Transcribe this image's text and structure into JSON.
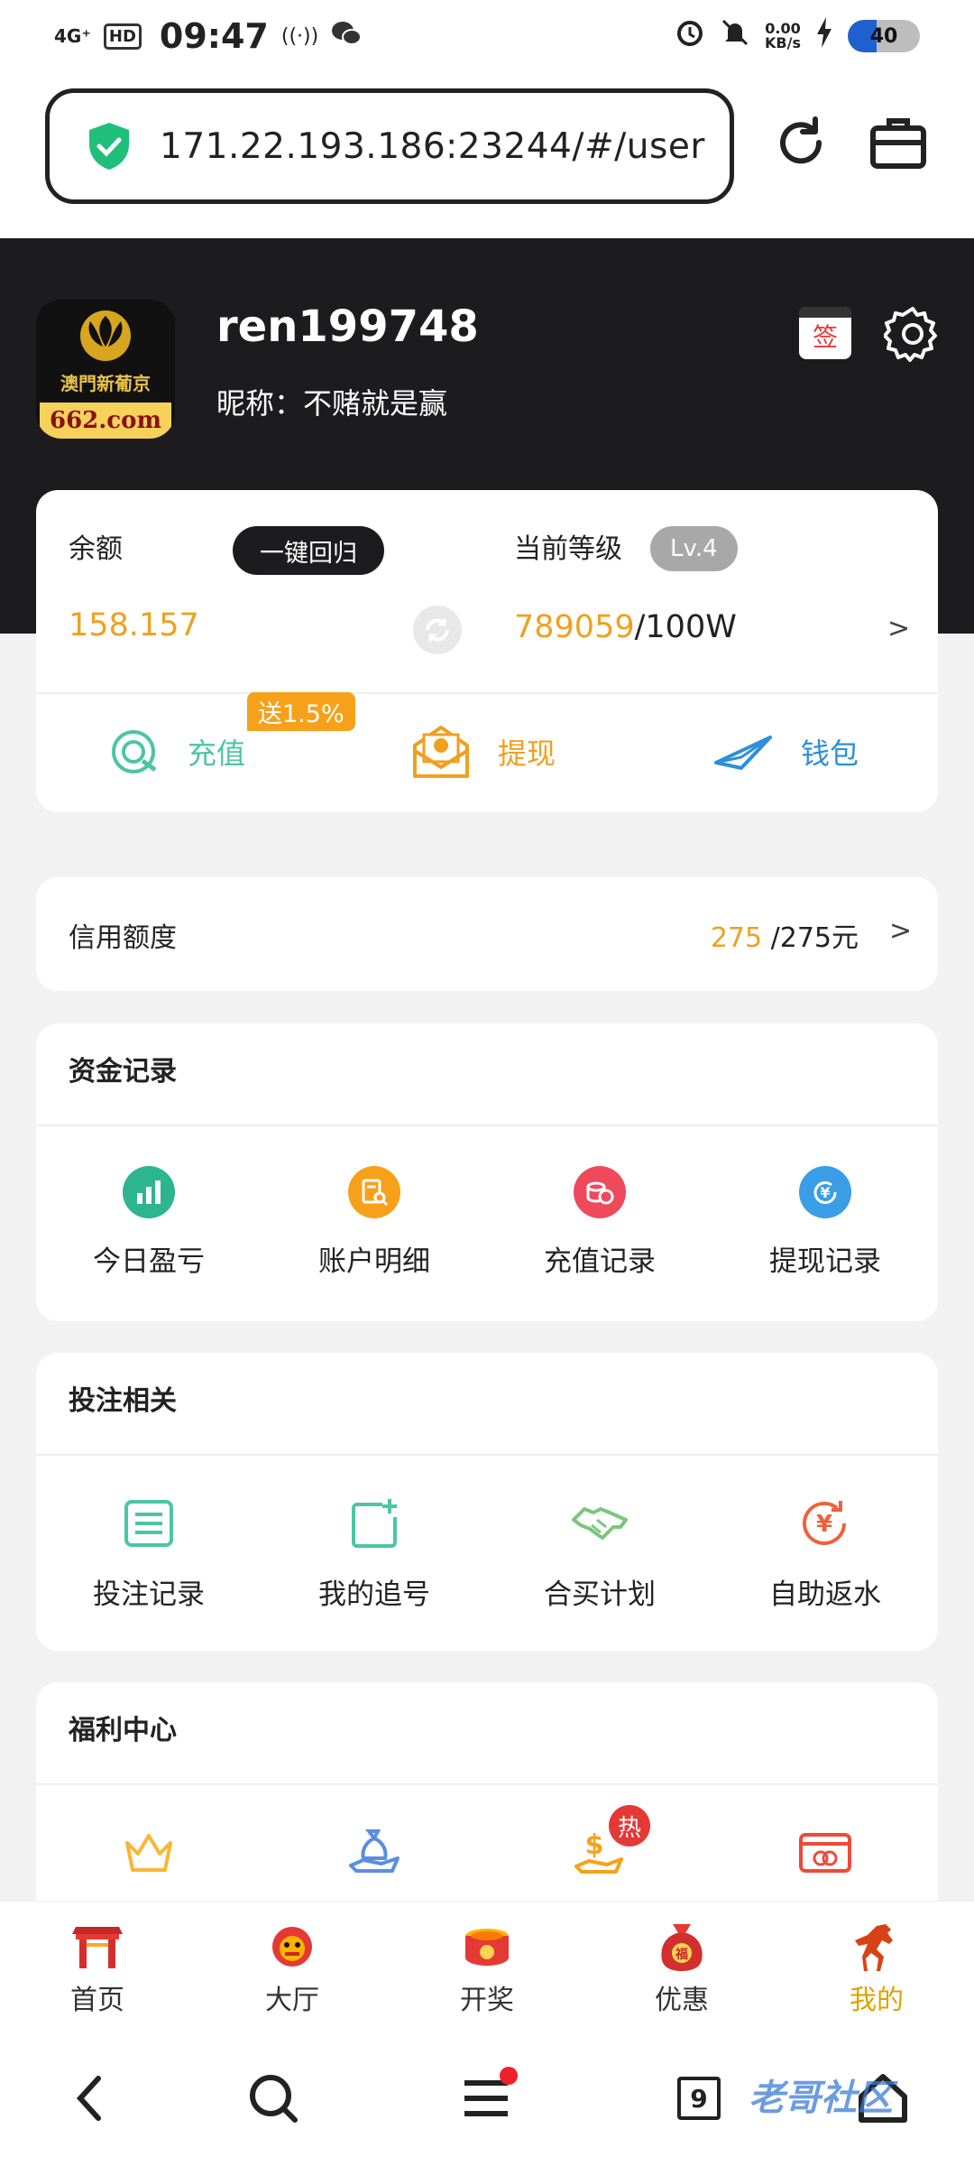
{
  "status_bar": {
    "network": "4G⁺",
    "hd": "HD",
    "time": "09:47",
    "speed_value": "0.00",
    "speed_unit": "KB/s",
    "battery": "40",
    "battery_level": 0.4
  },
  "browser": {
    "url": "171.22.193.186:23244/#/user",
    "refresh_icon": "refresh-icon",
    "toolbox_icon": "toolbox-icon"
  },
  "user": {
    "username": "ren199748",
    "nickname": "昵称：不赌就是赢",
    "avatar_lines": [
      "澳門新葡京",
      "662.com"
    ],
    "sign_label": "签"
  },
  "balance": {
    "label": "余额",
    "onekey_label": "一键回归",
    "value": "158.157",
    "level_label": "当前等级",
    "level_badge": "Lv.4",
    "level_current": "789059",
    "level_total": "/100W",
    "arrow": ">",
    "bonus_tag": "送1.5%",
    "actions": [
      {
        "label": "充值",
        "color": "#4cc5a3"
      },
      {
        "label": "提现",
        "color": "#f0a020"
      },
      {
        "label": "钱包",
        "color": "#2c8fd8"
      }
    ]
  },
  "credit": {
    "label": "信用额度",
    "current": "275",
    "total": " /275元",
    "arrow": ">"
  },
  "funds": {
    "title": "资金记录",
    "items": [
      {
        "label": "今日盈亏",
        "icon": "chart-icon",
        "color": "#2cb58e"
      },
      {
        "label": "账户明细",
        "icon": "document-search-icon",
        "color": "#f7a11b"
      },
      {
        "label": "充值记录",
        "icon": "coins-icon",
        "color": "#ef4a5c"
      },
      {
        "label": "提现记录",
        "icon": "yuan-cycle-icon",
        "color": "#3a9ee6"
      }
    ]
  },
  "betting": {
    "title": "投注相关",
    "items": [
      {
        "label": "投注记录",
        "icon": "list-icon",
        "color": "#4cc5a3"
      },
      {
        "label": "我的追号",
        "icon": "add-square-icon",
        "color": "#4cc5a3"
      },
      {
        "label": "合买计划",
        "icon": "handshake-icon",
        "color": "#7bc67b"
      },
      {
        "label": "自助返水",
        "icon": "yuan-refresh-icon",
        "color": "#f0603a"
      }
    ]
  },
  "welfare": {
    "title": "福利中心",
    "hot_label": "热",
    "items": [
      {
        "icon": "crown-icon",
        "color": "#f7b733"
      },
      {
        "icon": "money-bag-hand-icon",
        "color": "#5a8fe0"
      },
      {
        "icon": "dollar-hand-icon",
        "color": "#f7a11b"
      },
      {
        "icon": "card-icon",
        "color": "#ef4a3a"
      }
    ]
  },
  "tabs": [
    {
      "label": "首页",
      "icon": "gate-icon"
    },
    {
      "label": "大厅",
      "icon": "lion-icon"
    },
    {
      "label": "开奖",
      "icon": "drum-icon"
    },
    {
      "label": "优惠",
      "icon": "lucky-bag-icon"
    },
    {
      "label": "我的",
      "icon": "horse-icon",
      "active": true
    }
  ],
  "browser_nav": {
    "tab_count": "9",
    "watermark": "老哥社区"
  }
}
